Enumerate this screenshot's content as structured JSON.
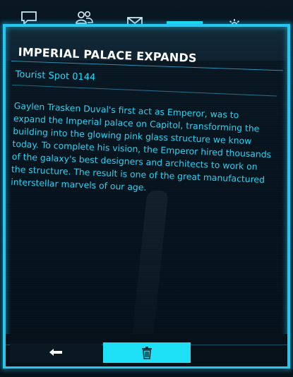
{
  "tabs": [
    {
      "id": "messages",
      "icon": "speech-bubble-icon"
    },
    {
      "id": "contacts",
      "icon": "people-icon"
    },
    {
      "id": "mail",
      "icon": "envelope-icon"
    },
    {
      "id": "codex",
      "icon": "list-icon",
      "active": true
    },
    {
      "id": "settings",
      "icon": "gear-icon"
    }
  ],
  "entry": {
    "title": "IMPERIAL PALACE EXPANDS",
    "subtitle": "Tourist Spot 0144",
    "body": "Gaylen Trasken Duval's first act as Emperor, was to expand the Imperial palace on Capitol, transforming the building into the glowing pink glass structure we know today. To complete his vision, the Emperor hired thousands of the galaxy's best designers and architects to work on the structure. The result is one of the great manufactured interstellar marvels of our age."
  },
  "footer": {
    "back_icon": "back-arrow-icon",
    "delete_icon": "trash-icon"
  },
  "colors": {
    "accent": "#1de0f5",
    "text": "#24d6f6",
    "title": "#ffffff",
    "background": "#081621"
  }
}
